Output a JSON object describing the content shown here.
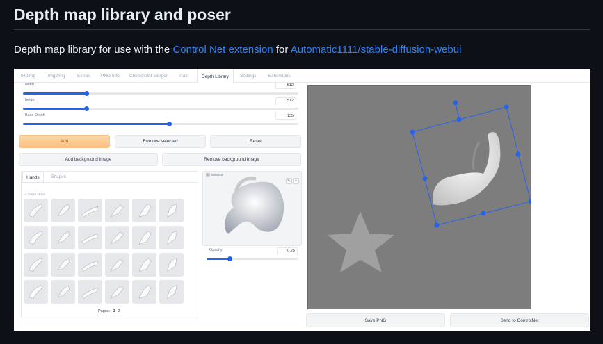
{
  "heading": "Depth map library and poser",
  "description": {
    "prefix": "Depth map library for use with the ",
    "link1": "Control Net extension",
    "middle": " for ",
    "link2": "Automatic1111/stable-diffusion-webui"
  },
  "tabs": [
    "txt2img",
    "img2img",
    "Extras",
    "PNG Info",
    "Checkpoint Merger",
    "Train",
    "Depth Library",
    "Settings",
    "Extensions"
  ],
  "active_tab": "Depth Library",
  "sliders": [
    {
      "label": "width",
      "value": "512",
      "fraction": 0.23
    },
    {
      "label": "height",
      "value": "512",
      "fraction": 0.23
    },
    {
      "label": "Base Depth",
      "value": "135",
      "fraction": 0.53
    }
  ],
  "buttons": {
    "add": "Add",
    "remove_selected": "Remove selected",
    "reset": "Reset",
    "add_background": "Add background image",
    "remove_background": "Remove background image",
    "save_png": "Save PNG",
    "send_to_controlnet": "Send to ControlNet"
  },
  "library": {
    "tabs": [
      "Hands",
      "Shapes"
    ],
    "active_tab": "Hands",
    "section_label": "☰ Depth Maps",
    "pages_label": "Pages:",
    "pages": [
      "1",
      "2"
    ]
  },
  "preview": {
    "label": "Selected",
    "opacity_label": "Opacity",
    "opacity_value": "0.25",
    "opacity_fraction": 0.25
  },
  "colors": {
    "page_bg": "#0d1117",
    "link": "#2f81f7",
    "accent": "#2563eb",
    "orange": "#fbbf80",
    "canvas_bg": "#7d7d7d"
  }
}
